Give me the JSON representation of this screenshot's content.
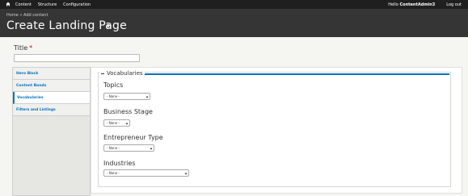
{
  "toolbar": {
    "home_icon": "home-icon",
    "menu": [
      "Content",
      "Structure",
      "Configuration"
    ],
    "hello_prefix": "Hello",
    "username": "ContentAdmin3",
    "logout": "Log out"
  },
  "header": {
    "breadcrumb": "Home » Add content",
    "title": "Create Landing Page",
    "shortcut_icon": "star-icon"
  },
  "title_field": {
    "label": "Title",
    "required_marker": "*",
    "value": ""
  },
  "tabs": [
    {
      "label": "Hero Block",
      "active": false
    },
    {
      "label": "Content Bands",
      "active": false
    },
    {
      "label": "Vocabularies",
      "active": true
    },
    {
      "label": "Filters and Listings",
      "active": false
    }
  ],
  "vocabularies": {
    "legend": "Vocabularies",
    "fields": [
      {
        "label": "Topics",
        "selected": "- None -"
      },
      {
        "label": "Business Stage",
        "selected": "- None -"
      },
      {
        "label": "Entrepreneur Type",
        "selected": "- None -"
      },
      {
        "label": "Industries",
        "selected": "- None -"
      }
    ]
  },
  "colors": {
    "toolbar": "#1f1f1f",
    "header": "#353535",
    "accent": "#0074bd",
    "required": "#d0021b"
  }
}
